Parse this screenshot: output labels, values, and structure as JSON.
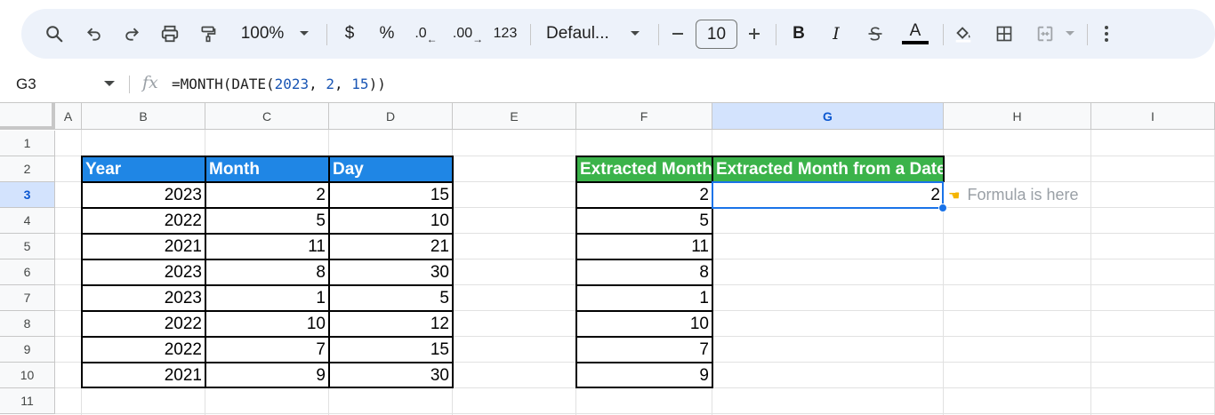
{
  "toolbar": {
    "zoom": "100%",
    "currency": "$",
    "percent": "%",
    "decrease_decimal": ".0",
    "increase_decimal": ".00",
    "format_123": "123",
    "font": "Defaul...",
    "font_size": "10",
    "bold": "B",
    "italic": "I",
    "text_color_letter": "A",
    "accent_color": "#0b57d0"
  },
  "formula_bar": {
    "cell_ref": "G3",
    "fx": "fx",
    "formula_prefix": "=MONTH(DATE(",
    "arg1": "2023",
    "sep1": ", ",
    "arg2": "2",
    "sep2": ", ",
    "arg3": "15",
    "formula_suffix": "))"
  },
  "columns": [
    "A",
    "B",
    "C",
    "D",
    "E",
    "F",
    "G",
    "H",
    "I"
  ],
  "rows": [
    "1",
    "2",
    "3",
    "4",
    "5",
    "6",
    "7",
    "8",
    "9",
    "10",
    "11"
  ],
  "selected": {
    "column": "G",
    "row": "3"
  },
  "table1": {
    "headers": [
      "Year",
      "Month",
      "Day"
    ],
    "header_color": "#1f86e5",
    "rows": [
      [
        "2023",
        "2",
        "15"
      ],
      [
        "2022",
        "5",
        "10"
      ],
      [
        "2021",
        "11",
        "21"
      ],
      [
        "2023",
        "8",
        "30"
      ],
      [
        "2023",
        "1",
        "5"
      ],
      [
        "2022",
        "10",
        "12"
      ],
      [
        "2022",
        "7",
        "15"
      ],
      [
        "2021",
        "9",
        "30"
      ]
    ]
  },
  "table2": {
    "headers": [
      "Extracted Month",
      "Extracted Month from a Date"
    ],
    "header_color": "#3bb34a",
    "values": [
      "2",
      "5",
      "11",
      "8",
      "1",
      "10",
      "7",
      "9"
    ],
    "g3_value": "2"
  },
  "annotation": {
    "icon": "pointing-hand-icon",
    "text": "Formula is here"
  }
}
